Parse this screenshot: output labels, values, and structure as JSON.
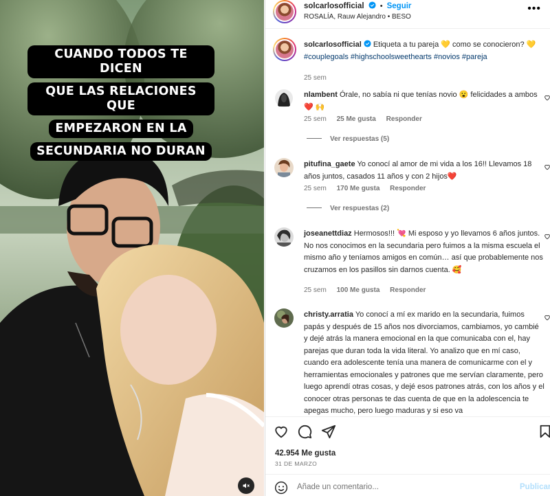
{
  "media": {
    "overlay_lines": [
      "CUANDO TODOS TE DICEN",
      "QUE LAS RELACIONES QUE",
      "EMPEZARON EN LA",
      "SECUNDARIA NO DURAN"
    ]
  },
  "header": {
    "username": "solcarlosofficial",
    "separator": "•",
    "follow_label": "Seguir",
    "audio": "ROSALÍA, Rauw Alejandro • BESO",
    "more_label": "•••"
  },
  "caption": {
    "username": "solcarlosofficial",
    "text": "Etiqueta a tu pareja 💛 como se conocieron? 💛",
    "hashtags": "#couplegoals #highschoolsweethearts #novios #pareja",
    "time": "25 sem"
  },
  "comments": [
    {
      "username": "nlambent",
      "text": "Órale, no sabía ni que tenías novio 😮 felicidades a ambos ❤️ 🙌",
      "time": "25 sem",
      "likes": "25 Me gusta",
      "reply_label": "Responder",
      "view_replies": "Ver respuestas (5)"
    },
    {
      "username": "pitufina_gaete",
      "text": "Yo conocí al amor de mi vida a los 16!! Llevamos 18 años juntos, casados 11 años y con 2 hijos❤️",
      "time": "25 sem",
      "likes": "170 Me gusta",
      "reply_label": "Responder",
      "view_replies": "Ver respuestas (2)"
    },
    {
      "username": "joseanettdiaz",
      "text": "Hermosos!!! 💘 Mi esposo y yo llevamos 6 años juntos. No nos conocimos en la secundaria pero fuimos a la misma escuela el mismo año y teníamos amigos en común… así que probablemente nos cruzamos en los pasillos sin darnos cuenta. 🥰",
      "time": "25 sem",
      "likes": "100 Me gusta",
      "reply_label": "Responder"
    },
    {
      "username": "christy.arratia",
      "text": "Yo conocí a mí ex marido en la secundaria, fuimos papás y después de 15 años nos divorciamos, cambiamos, yo cambié y dejé atrás la manera emocional en la que comunicaba con el, hay parejas que duran toda la vida literal. Yo analizo que en mí caso, cuando era adolescente tenía una manera de comunicarme con el y herramientas emocionales y patrones que me servían claramente, pero luego aprendí otras cosas, y dejé esos patrones atrás, con los años y el conocer otras personas te das cuenta de que en la adolescencia te apegas mucho, pero luego maduras y si eso va"
    }
  ],
  "actions": {
    "likes": "42.954 Me gusta",
    "date": "31 DE MARZO"
  },
  "add_comment": {
    "placeholder": "Añade un comentario...",
    "publish_label": "Publicar"
  },
  "colors": {
    "accent": "#0095f6",
    "link": "#00376b",
    "muted": "#737373",
    "publish_disabled": "#b2dffc"
  },
  "icons": [
    "heart-icon",
    "comment-icon",
    "share-icon",
    "bookmark-icon",
    "emoji-icon",
    "verified-icon",
    "mute-icon"
  ]
}
